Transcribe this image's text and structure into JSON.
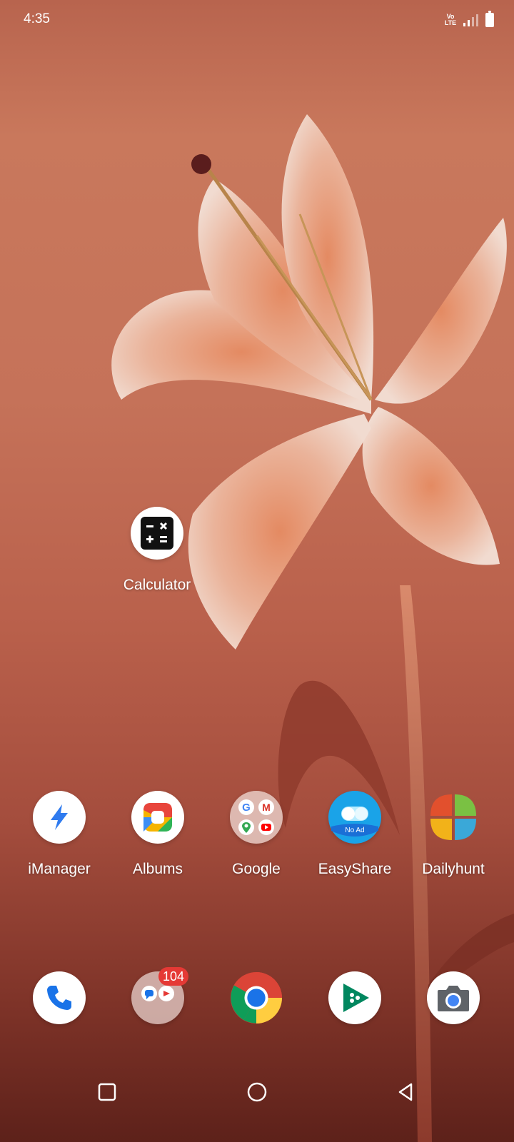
{
  "status_bar": {
    "time": "4:35",
    "network_label": "Vo LTE",
    "icons": [
      "volte-icon",
      "signal-icon",
      "battery-icon"
    ]
  },
  "desktop": {
    "apps": [
      {
        "label": "Calculator",
        "icon": "calculator-icon"
      }
    ]
  },
  "app_row": [
    {
      "label": "iManager",
      "icon": "imanager-icon"
    },
    {
      "label": "Albums",
      "icon": "albums-icon"
    },
    {
      "label": "Google",
      "icon": "google-folder-icon"
    },
    {
      "label": "EasyShare",
      "icon": "easyshare-icon",
      "icon_text": "No Ad"
    },
    {
      "label": "Dailyhunt",
      "icon": "dailyhunt-icon"
    }
  ],
  "dock": [
    {
      "icon": "phone-icon"
    },
    {
      "icon": "messages-folder-icon",
      "badge": "104"
    },
    {
      "icon": "chrome-icon"
    },
    {
      "icon": "play-games-icon"
    },
    {
      "icon": "camera-icon"
    }
  ],
  "nav_bar": {
    "buttons": [
      "recents-button",
      "home-button",
      "back-button"
    ]
  },
  "colors": {
    "badge": "#e53935",
    "wallpaper_top": "#c9785c",
    "wallpaper_bottom": "#5d211a"
  }
}
